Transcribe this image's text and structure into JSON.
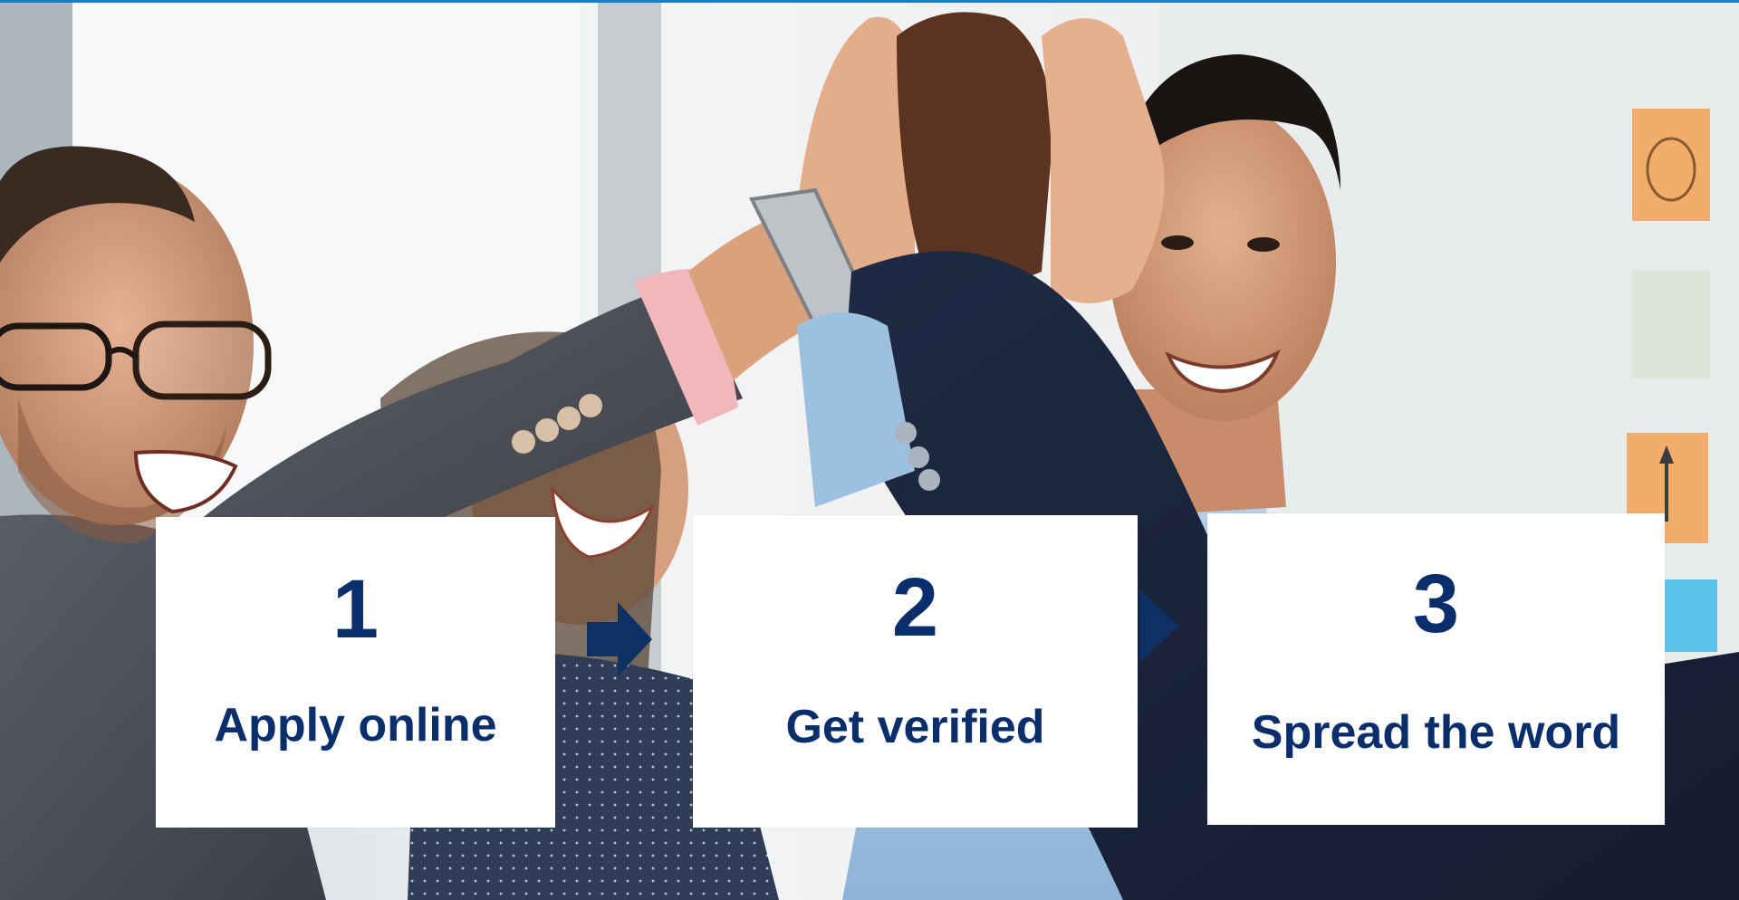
{
  "colors": {
    "accent_top_rule": "#1b7fc4",
    "step_text": "#0a2d6b",
    "arrow": "#0e3164",
    "card_bg": "#ffffff"
  },
  "hero": {
    "image": "team-high-five-photo"
  },
  "steps": [
    {
      "number": "1",
      "label": "Apply online"
    },
    {
      "number": "2",
      "label": "Get verified"
    },
    {
      "number": "3",
      "label": "Spread the word"
    }
  ],
  "connectors": [
    {
      "icon": "arrow-right-icon"
    },
    {
      "icon": "arrow-right-icon"
    }
  ]
}
